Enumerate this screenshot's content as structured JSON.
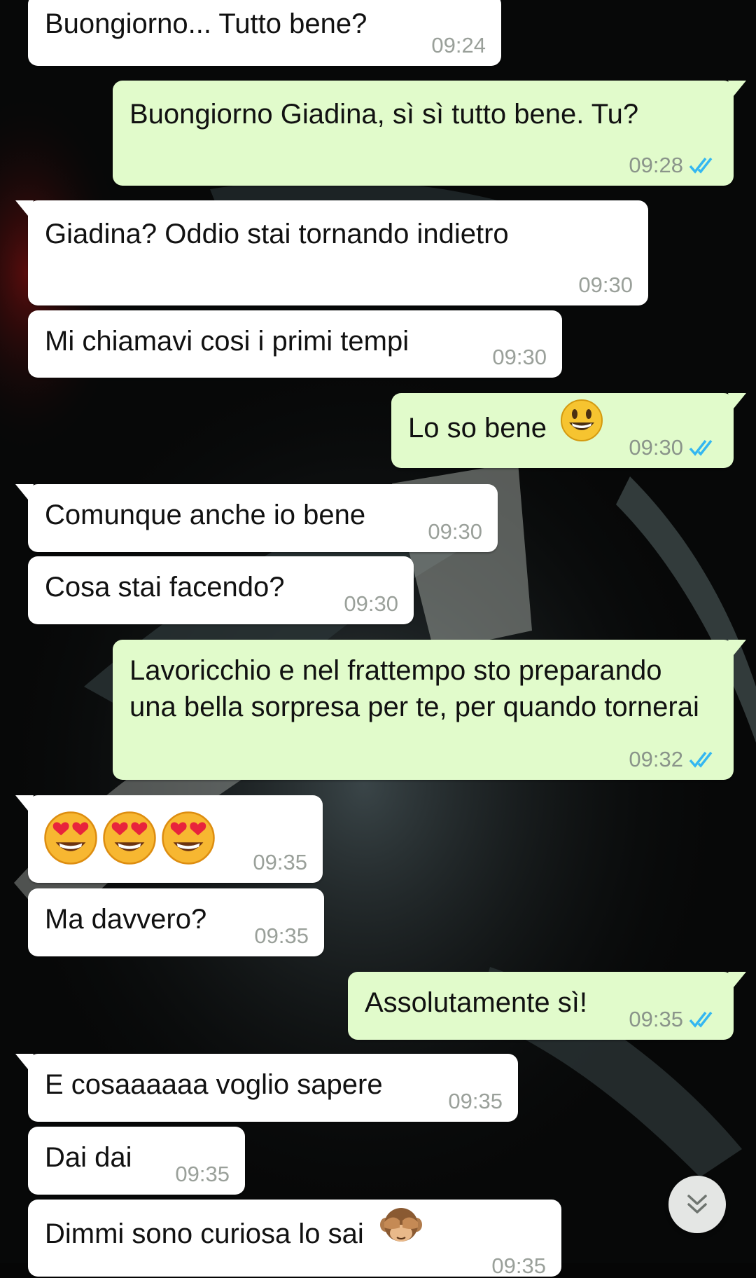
{
  "messages": [
    {
      "id": "m1",
      "dir": "in",
      "text": "Buongiorno... Tutto bene?",
      "time": "09:24"
    },
    {
      "id": "m2",
      "dir": "out",
      "text": "Buongiorno Giadina, sì sì tutto bene. Tu?",
      "time": "09:28",
      "status": "read"
    },
    {
      "id": "m3",
      "dir": "in",
      "text": "Giadina? Oddio stai tornando indietro",
      "time": "09:30"
    },
    {
      "id": "m4",
      "dir": "in",
      "text": "Mi chiamavi cosi i primi tempi",
      "time": "09:30"
    },
    {
      "id": "m5",
      "dir": "out",
      "text": "Lo so bene",
      "emoji": "smiley-emoji",
      "time": "09:30",
      "status": "read"
    },
    {
      "id": "m6",
      "dir": "in",
      "text": "Comunque anche io bene",
      "time": "09:30"
    },
    {
      "id": "m7",
      "dir": "in",
      "text": "Cosa stai facendo?",
      "time": "09:30"
    },
    {
      "id": "m8",
      "dir": "out",
      "text": "Lavoricchio e nel frattempo sto preparando una bella sorpresa per te, per quando tornerai",
      "time": "09:32",
      "status": "read"
    },
    {
      "id": "m9",
      "dir": "in",
      "text": "",
      "emoji": "heart-eyes-emoji x3",
      "time": "09:35"
    },
    {
      "id": "m10",
      "dir": "in",
      "text": "Ma davvero?",
      "time": "09:35"
    },
    {
      "id": "m11",
      "dir": "out",
      "text": "Assolutamente sì!",
      "time": "09:35",
      "status": "read"
    },
    {
      "id": "m12",
      "dir": "in",
      "text": "E cosaaaaaa voglio sapere",
      "time": "09:35"
    },
    {
      "id": "m13",
      "dir": "in",
      "text": "Dai dai",
      "time": "09:35"
    },
    {
      "id": "m14",
      "dir": "in",
      "text": "Dimmi sono curiosa lo sai",
      "emoji": "see-no-evil-monkey-emoji",
      "time": "09:35"
    }
  ],
  "controls": {
    "scroll_down_icon": "double-chevron-down-icon"
  },
  "colors": {
    "incoming_bubble": "#ffffff",
    "outgoing_bubble": "#e1fbcb",
    "read_ticks": "#34b7f1",
    "timestamp": "#8a948a"
  }
}
